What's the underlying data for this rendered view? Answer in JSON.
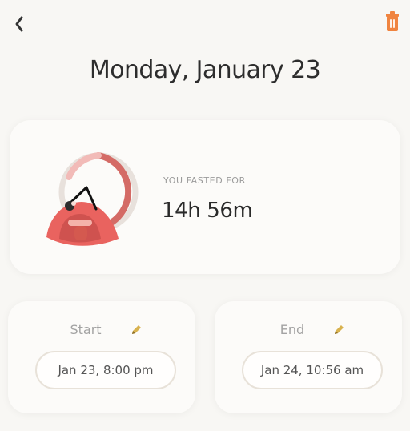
{
  "header": {
    "back_icon": "chevron-left-icon",
    "trash_icon": "trash-icon",
    "title": "Monday, January 23"
  },
  "summary": {
    "label": "YOU FASTED FOR",
    "duration": "14h 56m",
    "illustration": "fasting-clock-illustration"
  },
  "times": {
    "start": {
      "label": "Start",
      "value": "Jan 23, 8:00 pm",
      "edit_icon": "pencil-icon"
    },
    "end": {
      "label": "End",
      "value": "Jan 24, 10:56 am",
      "edit_icon": "pencil-icon"
    }
  },
  "colors": {
    "background": "#f8f7f4",
    "card": "#fcfbf9",
    "accent_red": "#e5645d",
    "accent_orange": "#f27d3a",
    "pencil_gold": "#d8b24f"
  }
}
